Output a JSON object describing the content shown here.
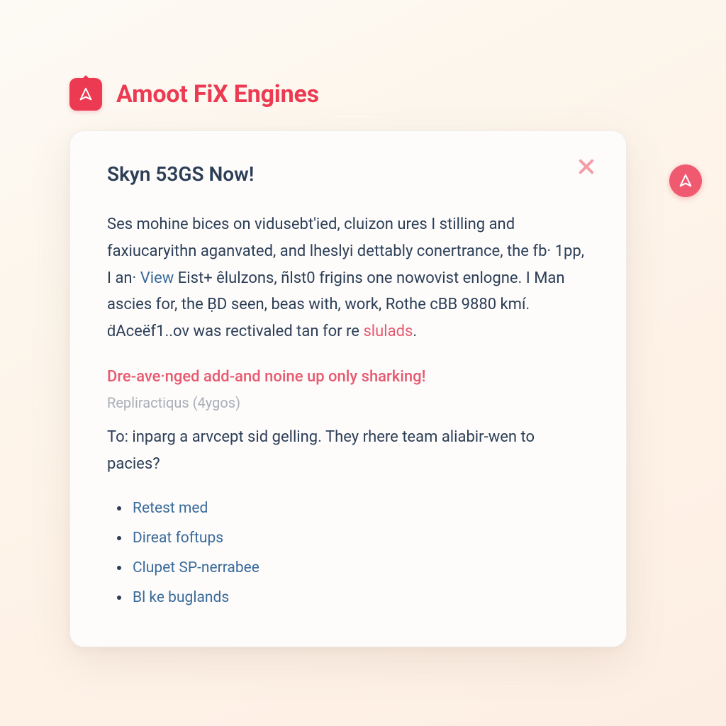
{
  "brand": "Amoot FiX Engines",
  "colors": {
    "accent": "#eb3a52",
    "text": "#2c3e56",
    "link": "#3a6a9a",
    "muted": "#a9aeb7"
  },
  "icons": {
    "logo": "A",
    "side": "A"
  },
  "card": {
    "title": "Skyn 53GS Now!",
    "body_plain": "Ses mohine bices on vidusebt'ied, cluizon ures I stilling and faxiucaryithn aganvated, and lheslyi dettably conertrance, the fb· 1pp, I an· View Eist+ êlulzons, ñlst0 frigins one nowovist enlogne. I Man ascies for, the ḄD seen, beas with, work, Rothe cBB 9880 kmí. ḋAceëf1..ov was rectivaled tan for re slulads.",
    "body_segments": [
      {
        "text": "Ses mohine bices on vidusebt'ied, cluizon ures I stilling and faxiucaryithn aganvated, and lheslyi dettably conertrance, the fb· 1pp, I an· "
      },
      {
        "text": "View",
        "link": true
      },
      {
        "text": " Eist+ êlulzons, ñlst0 frigins one nowovist enlogne. I Man ascies for, the ḄD seen, beas with, work, Rothe cBB 9880 kmí. ḋAceëf1..ov was rectivaled tan for re "
      },
      {
        "text": "slulads",
        "highlight": true
      },
      {
        "text": "."
      }
    ],
    "emphasis": "Dre-ave·nged add-and noine up only sharking!",
    "meta": "Repliractiqus (4ygos)",
    "question": "To: inparg a arvcept sid gelling. They rhere team aliabir-wen to pacies?",
    "links": [
      "Retest med",
      "Direat foftups",
      "Clupet SP-nerrabee",
      "Bl ke buglands"
    ]
  }
}
